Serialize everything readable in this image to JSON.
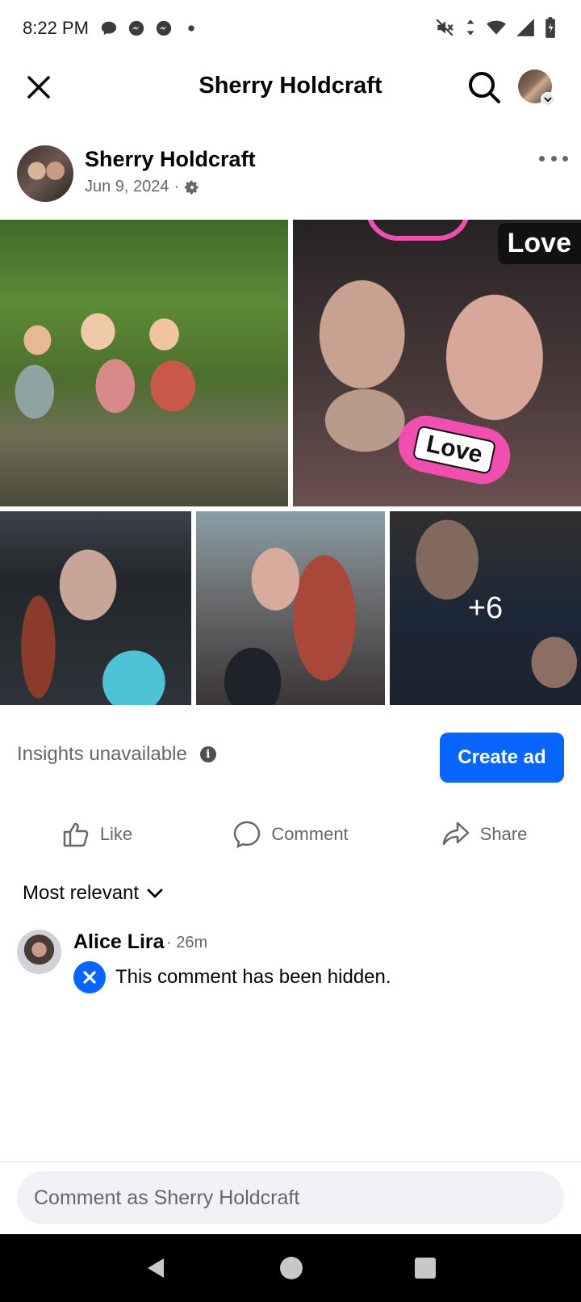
{
  "status_bar": {
    "time": "8:22 PM"
  },
  "header": {
    "title": "Sherry Holdcraft"
  },
  "post": {
    "author": "Sherry Holdcraft",
    "date": "Jun 9, 2024",
    "separator": "·",
    "photos": {
      "love_sticker_text": "Love",
      "love_corner_text": "Love",
      "more_count": "+6"
    }
  },
  "insights": {
    "text": "Insights unavailable",
    "create_ad_label": "Create ad"
  },
  "actions": {
    "like_label": "Like",
    "comment_label": "Comment",
    "share_label": "Share"
  },
  "comments": {
    "sort_label": "Most relevant",
    "items": [
      {
        "author": "Alice Lira",
        "time": "· 26m",
        "text": "This comment has been hidden."
      }
    ]
  },
  "composer": {
    "placeholder": "Comment as Sherry Holdcraft"
  },
  "colors": {
    "accent": "#0866ff",
    "secondary_text": "#65676b"
  }
}
